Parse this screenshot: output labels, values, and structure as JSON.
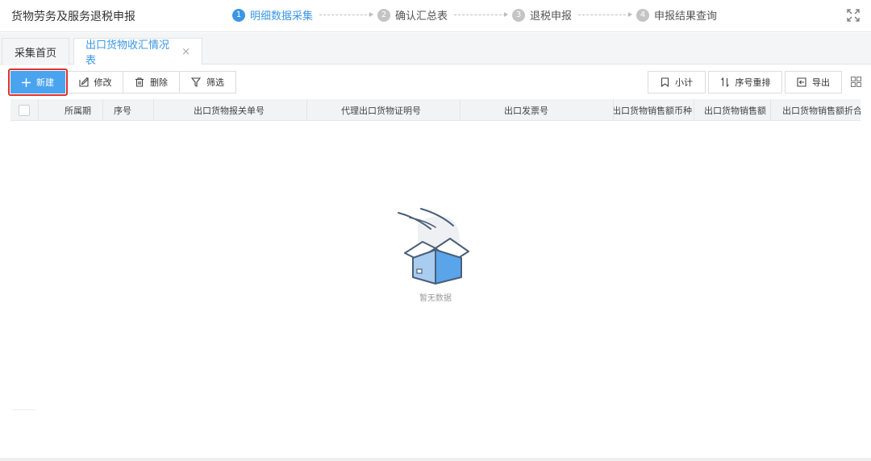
{
  "header": {
    "title": "货物劳务及服务退税申报",
    "steps": [
      {
        "num": "1",
        "label": "明细数据采集"
      },
      {
        "num": "2",
        "label": "确认汇总表"
      },
      {
        "num": "3",
        "label": "退税申报"
      },
      {
        "num": "4",
        "label": "申报结果查询"
      }
    ]
  },
  "tabs": [
    {
      "label": "采集首页"
    },
    {
      "label": "出口货物收汇情况表",
      "close": "×"
    }
  ],
  "toolbar": {
    "new_label": "新建",
    "edit_label": "修改",
    "delete_label": "删除",
    "filter_label": "筛选",
    "subtotal_label": "小计",
    "reorder_label": "序号重排",
    "export_label": "导出"
  },
  "table": {
    "columns": [
      "所属期",
      "序号",
      "出口货物报关单号",
      "代理出口货物证明号",
      "出口发票号",
      "出口货物销售额币种",
      "出口货物销售额",
      "出口货物销售额折合"
    ]
  },
  "empty_state": {
    "text": "暂无数据"
  },
  "colors": {
    "accent": "#3b97e3",
    "primary_button": "#4aa3ee",
    "highlight_border": "#e0322b"
  }
}
